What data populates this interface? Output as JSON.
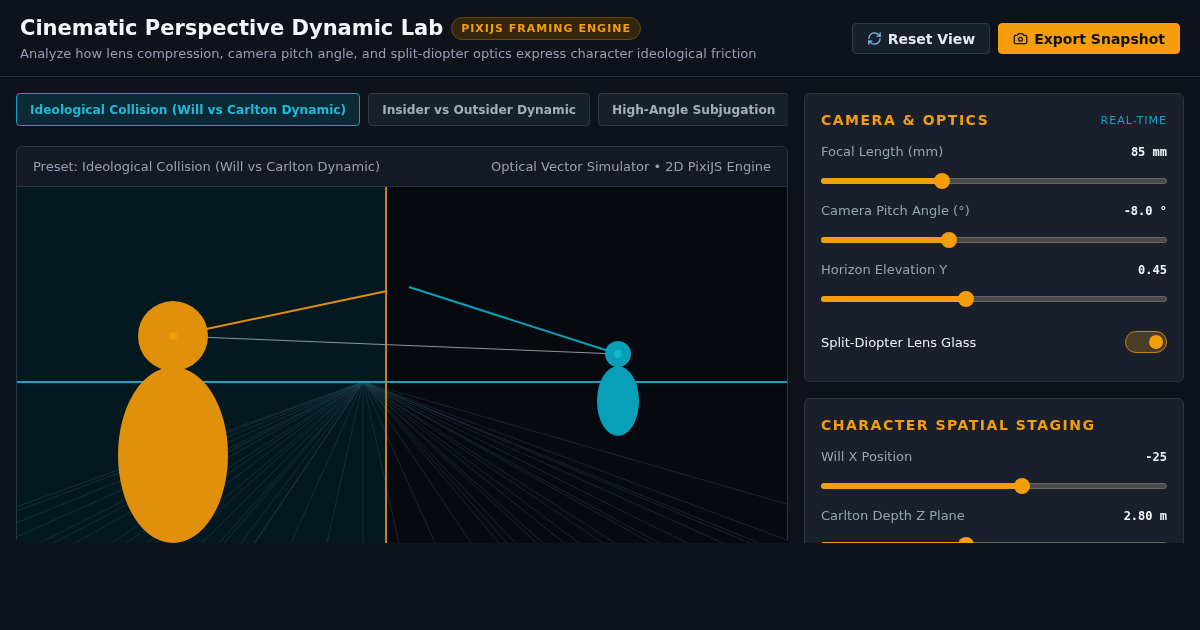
{
  "header": {
    "title": "Cinematic Perspective Dynamic Lab",
    "badge": "PIXIJS FRAMING ENGINE",
    "subtitle": "Analyze how lens compression, camera pitch angle, and split-diopter optics express character ideological friction",
    "buttons": [
      {
        "label": "Reset View",
        "kind": "secondary"
      },
      {
        "label": "Export Snapshot",
        "kind": "primary"
      }
    ]
  },
  "tabs": [
    {
      "label": "Ideological Collision (Will vs Carlton Dynamic)",
      "selected": true
    },
    {
      "label": "Insider vs Outsider Dynamic",
      "selected": false
    },
    {
      "label": "High-Angle Subjugation",
      "selected": false
    }
  ],
  "viewport": {
    "preset": "Preset: Ideological Collision (Will vs Carlton Dynamic)",
    "engine": "Optical Vector Simulator • 2D PixiJS Engine",
    "split_diopter": true
  },
  "panels": [
    {
      "title": "CAMERA & OPTICS",
      "tag": "REAL-TIME",
      "controls": [
        {
          "kind": "slider",
          "label": "Focal Length (mm)",
          "value": "85 mm",
          "level": 0.35
        },
        {
          "kind": "slider",
          "label": "Camera Pitch Angle (°)",
          "value": "-8.0 °",
          "level": 0.37
        },
        {
          "kind": "slider",
          "label": "Horizon Elevation Y",
          "value": "0.45",
          "level": 0.42
        },
        {
          "kind": "toggle",
          "label": "Split-Diopter Lens Glass",
          "on": true
        }
      ]
    },
    {
      "title": "CHARACTER SPATIAL STAGING",
      "controls": [
        {
          "kind": "slider",
          "label": "Will X Position",
          "value": "-25",
          "level": 0.58
        },
        {
          "kind": "slider",
          "label": "Carlton Depth Z Plane",
          "value": "2.80 m",
          "level": 0.42
        }
      ]
    }
  ]
}
